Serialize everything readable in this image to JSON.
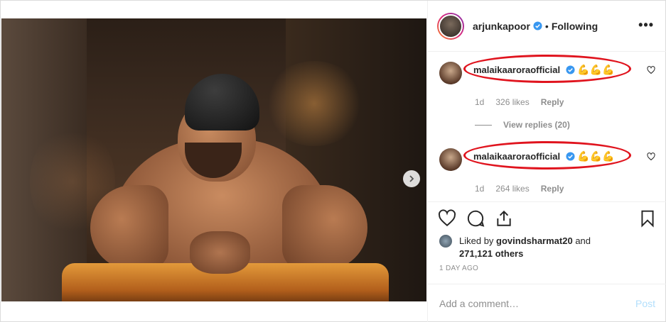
{
  "post": {
    "author": "arjunkapoor",
    "follow_status": "Following",
    "more_label": "•••",
    "carousel_total": 2,
    "carousel_index": 1
  },
  "comments": [
    {
      "username": "malaikaaroraofficial",
      "text": "💪💪💪",
      "age": "1d",
      "likes": "326 likes",
      "reply_label": "Reply"
    },
    {
      "username": "malaikaaroraofficial",
      "text": "💪💪💪",
      "age": "1d",
      "likes": "264 likes",
      "reply_label": "Reply"
    }
  ],
  "view_replies": "View replies (20)",
  "liked_by": {
    "prefix": "Liked by ",
    "user": "govindsharmat20",
    "mid": " and",
    "others": "271,121 others"
  },
  "timestamp": "1 DAY AGO",
  "add_comment": {
    "placeholder": "Add a comment…",
    "post_label": "Post"
  },
  "colors": {
    "annotation_red": "#e0141e",
    "verified_blue": "#3897f0",
    "post_disabled": "#b2dffc"
  },
  "icons": [
    "heart-icon",
    "comment-icon",
    "share-icon",
    "bookmark-icon",
    "verified-badge-icon",
    "chevron-right-icon"
  ]
}
